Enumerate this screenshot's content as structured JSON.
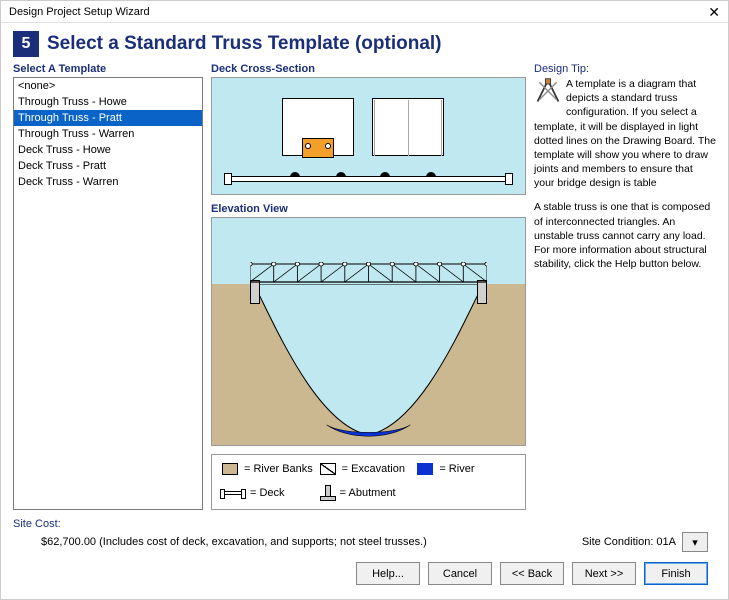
{
  "window": {
    "title": "Design Project Setup Wizard"
  },
  "step": {
    "number": "5",
    "title": "Select a Standard Truss Template (optional)"
  },
  "templateList": {
    "label": "Select A Template",
    "items": [
      "<none>",
      "Through Truss - Howe",
      "Through Truss - Pratt",
      "Through Truss - Warren",
      "Deck Truss - Howe",
      "Deck Truss - Pratt",
      "Deck Truss - Warren"
    ],
    "selectedIndex": 2
  },
  "crossSection": {
    "label": "Deck Cross-Section"
  },
  "elevation": {
    "label": "Elevation View"
  },
  "legend": {
    "banks": "= River Banks",
    "excavation": "= Excavation",
    "river": "= River",
    "deck": "= Deck",
    "abutment": "= Abutment"
  },
  "tip": {
    "label": "Design Tip:",
    "para1": "A template is a diagram that depicts a standard truss configuration. If you select a template, it will be displayed in light dotted lines on the Drawing Board. The template will show you where to draw joints and members to ensure that your bridge design is table",
    "para2": "A stable truss is one that is composed of interconnected triangles. An unstable truss cannot carry any load. For more information about structural stability, click the Help button below."
  },
  "siteCost": {
    "label": "Site Cost:",
    "text": "$62,700.00  (Includes cost of deck, excavation, and supports; not steel trusses.)"
  },
  "siteCondition": {
    "label": "Site Condition: 01A"
  },
  "buttons": {
    "help": "Help...",
    "cancel": "Cancel",
    "back": "<< Back",
    "next": "Next >>",
    "finish": "Finish"
  }
}
